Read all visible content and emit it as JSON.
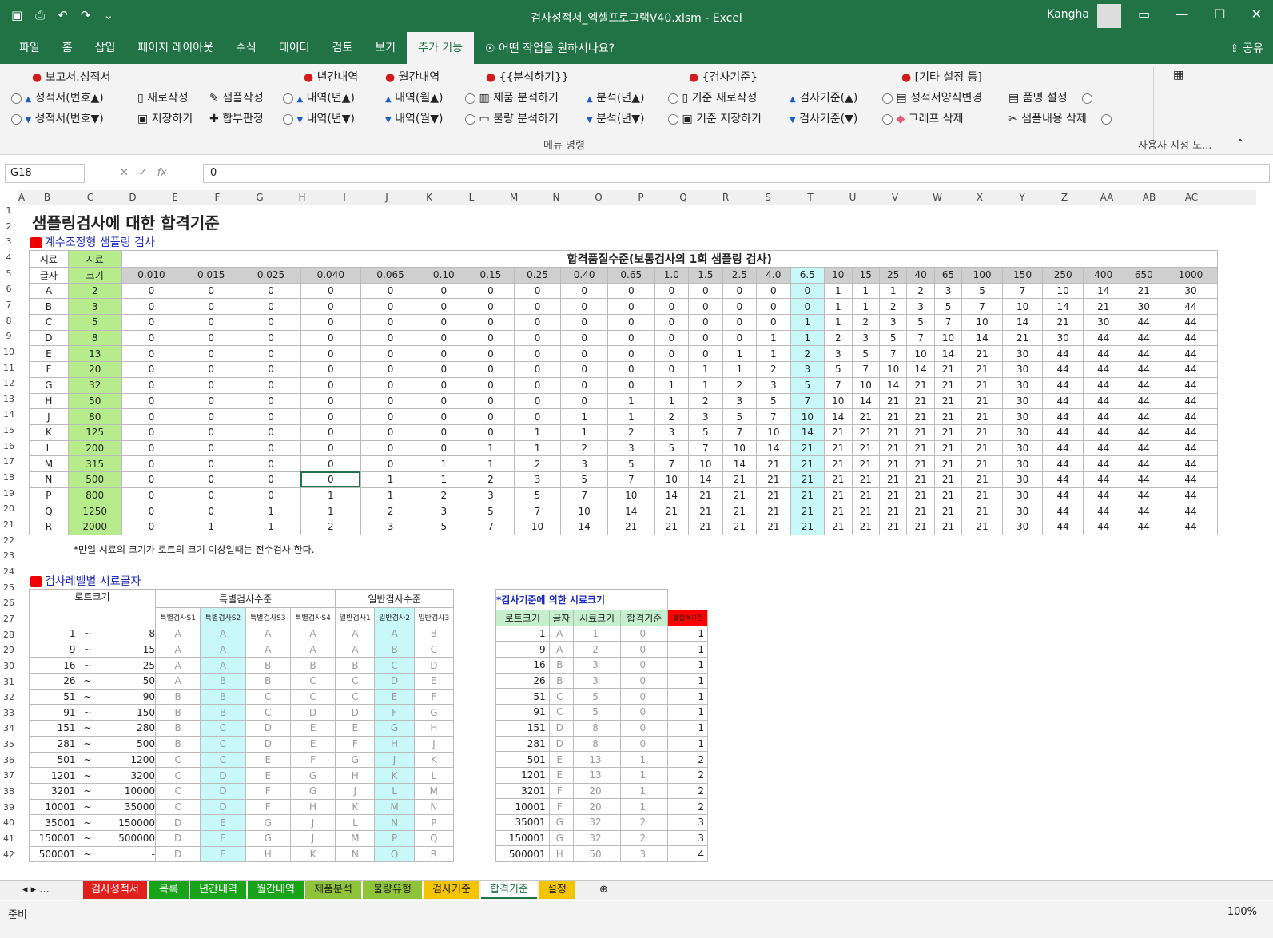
{
  "window": {
    "title": "검사성적서_엑셀프로그램V40.xlsm  -  Excel",
    "user": "Kangha"
  },
  "menu": {
    "tabs": [
      "파일",
      "홈",
      "삽입",
      "페이지 레이아웃",
      "수식",
      "데이터",
      "검토",
      "보기",
      "추가 기능"
    ],
    "active": "추가 기능",
    "tell": "어떤 작업을 원하시나요?",
    "share": "공유"
  },
  "ribbon": {
    "col1": {
      "head": "보고서.성적서",
      "r1": "성적서(번호▲)",
      "r2": "성적서(번호▼)"
    },
    "col2": {
      "r1": "새로작성",
      "r2": "저장하기"
    },
    "col3": {
      "r1": "샘플작성",
      "r2": "합부판정"
    },
    "col4": {
      "head": "년간내역",
      "r1": "내역(년▲)",
      "r2": "내역(년▼)"
    },
    "col5": {
      "head": "월간내역",
      "r1": "내역(월▲)",
      "r2": "내역(월▼)"
    },
    "col6": {
      "head": "{{분석하기}}",
      "r1": "제품 분석하기",
      "r2": "불량 분석하기"
    },
    "col7": {
      "r1": "분석(년▲)",
      "r2": "분석(년▼)"
    },
    "col8": {
      "head": "{검사기준}",
      "r1": "기준 새로작성",
      "r2": "기준 저장하기"
    },
    "col9": {
      "r1": "검사기준(▲)",
      "r2": "검사기준(▼)"
    },
    "col10": {
      "head": "[기타 설정 등]",
      "r1": "성적서양식변경",
      "r2": "그래프 삭제"
    },
    "col11": {
      "r1": "품명 설정",
      "r2": "샘플내용 삭제"
    },
    "group_label": "메뉴 명령",
    "custom_label": "사용자 지정 도..."
  },
  "formula": {
    "cell": "G18",
    "value": "0"
  },
  "columns": [
    "A",
    "B",
    "C",
    "D",
    "E",
    "F",
    "G",
    "H",
    "I",
    "J",
    "K",
    "L",
    "M",
    "N",
    "O",
    "P",
    "Q",
    "R",
    "S",
    "T",
    "U",
    "V",
    "W",
    "X",
    "Y",
    "Z",
    "AA",
    "AB",
    "AC"
  ],
  "rows": [
    "1",
    "2",
    "3",
    "4",
    "5",
    "6",
    "7",
    "8",
    "9",
    "10",
    "11",
    "12",
    "13",
    "14",
    "15",
    "16",
    "17",
    "18",
    "19",
    "20",
    "21",
    "22",
    "23",
    "24",
    "25",
    "26",
    "27",
    "28",
    "29",
    "30",
    "31",
    "32",
    "33",
    "34",
    "35",
    "36",
    "37",
    "38",
    "39",
    "40",
    "41",
    "42"
  ],
  "title": "샘플링검사에 대한 합격기준",
  "section1": "계수조정형 샘플링 검사",
  "section2": "검사레벨별 시료글자",
  "note": "*만일 시료의 크기가 로트의 크기 이상일때는 전수검사 한다.",
  "table1": {
    "h_letter": [
      "시료",
      "글자"
    ],
    "h_size": [
      "시료",
      "크기"
    ],
    "h_aql": "합격품질수준(보통검사의 1회 샘플링 검사)",
    "aql": [
      "0.010",
      "0.015",
      "0.025",
      "0.040",
      "0.065",
      "0.10",
      "0.15",
      "0.25",
      "0.40",
      "0.65",
      "1.0",
      "1.5",
      "2.5",
      "4.0",
      "6.5",
      "10",
      "15",
      "25",
      "40",
      "65",
      "100",
      "150",
      "250",
      "400",
      "650",
      "1000"
    ],
    "rows": [
      [
        "A",
        "2",
        [
          0,
          0,
          0,
          0,
          0,
          0,
          0,
          0,
          0,
          0,
          0,
          0,
          0,
          0,
          0,
          1,
          1,
          1,
          2,
          3,
          5,
          7,
          10,
          14,
          21,
          30
        ]
      ],
      [
        "B",
        "3",
        [
          0,
          0,
          0,
          0,
          0,
          0,
          0,
          0,
          0,
          0,
          0,
          0,
          0,
          0,
          0,
          1,
          1,
          2,
          3,
          5,
          7,
          10,
          14,
          21,
          30,
          44
        ]
      ],
      [
        "C",
        "5",
        [
          0,
          0,
          0,
          0,
          0,
          0,
          0,
          0,
          0,
          0,
          0,
          0,
          0,
          0,
          1,
          1,
          2,
          3,
          5,
          7,
          10,
          14,
          21,
          30,
          44,
          44
        ]
      ],
      [
        "D",
        "8",
        [
          0,
          0,
          0,
          0,
          0,
          0,
          0,
          0,
          0,
          0,
          0,
          0,
          0,
          1,
          1,
          2,
          3,
          5,
          7,
          10,
          14,
          21,
          30,
          44,
          44,
          44
        ]
      ],
      [
        "E",
        "13",
        [
          0,
          0,
          0,
          0,
          0,
          0,
          0,
          0,
          0,
          0,
          0,
          0,
          1,
          1,
          2,
          3,
          5,
          7,
          10,
          14,
          21,
          30,
          44,
          44,
          44,
          44
        ]
      ],
      [
        "F",
        "20",
        [
          0,
          0,
          0,
          0,
          0,
          0,
          0,
          0,
          0,
          0,
          0,
          1,
          1,
          2,
          3,
          5,
          7,
          10,
          14,
          21,
          21,
          30,
          44,
          44,
          44,
          44
        ]
      ],
      [
        "G",
        "32",
        [
          0,
          0,
          0,
          0,
          0,
          0,
          0,
          0,
          0,
          0,
          1,
          1,
          2,
          3,
          5,
          7,
          10,
          14,
          21,
          21,
          21,
          30,
          44,
          44,
          44,
          44
        ]
      ],
      [
        "H",
        "50",
        [
          0,
          0,
          0,
          0,
          0,
          0,
          0,
          0,
          0,
          1,
          1,
          2,
          3,
          5,
          7,
          10,
          14,
          21,
          21,
          21,
          21,
          30,
          44,
          44,
          44,
          44
        ]
      ],
      [
        "J",
        "80",
        [
          0,
          0,
          0,
          0,
          0,
          0,
          0,
          0,
          1,
          1,
          2,
          3,
          5,
          7,
          10,
          14,
          21,
          21,
          21,
          21,
          21,
          30,
          44,
          44,
          44,
          44
        ]
      ],
      [
        "K",
        "125",
        [
          0,
          0,
          0,
          0,
          0,
          0,
          0,
          1,
          1,
          2,
          3,
          5,
          7,
          10,
          14,
          21,
          21,
          21,
          21,
          21,
          21,
          30,
          44,
          44,
          44,
          44
        ]
      ],
      [
        "L",
        "200",
        [
          0,
          0,
          0,
          0,
          0,
          0,
          1,
          1,
          2,
          3,
          5,
          7,
          10,
          14,
          21,
          21,
          21,
          21,
          21,
          21,
          21,
          30,
          44,
          44,
          44,
          44
        ]
      ],
      [
        "M",
        "315",
        [
          0,
          0,
          0,
          0,
          0,
          1,
          1,
          2,
          3,
          5,
          7,
          10,
          14,
          21,
          21,
          21,
          21,
          21,
          21,
          21,
          21,
          30,
          44,
          44,
          44,
          44
        ]
      ],
      [
        "N",
        "500",
        [
          0,
          0,
          0,
          0,
          1,
          1,
          2,
          3,
          5,
          7,
          10,
          14,
          21,
          21,
          21,
          21,
          21,
          21,
          21,
          21,
          21,
          30,
          44,
          44,
          44,
          44
        ]
      ],
      [
        "P",
        "800",
        [
          0,
          0,
          0,
          1,
          1,
          2,
          3,
          5,
          7,
          10,
          14,
          21,
          21,
          21,
          21,
          21,
          21,
          21,
          21,
          21,
          21,
          30,
          44,
          44,
          44,
          44
        ]
      ],
      [
        "Q",
        "1250",
        [
          0,
          0,
          1,
          1,
          2,
          3,
          5,
          7,
          10,
          14,
          21,
          21,
          21,
          21,
          21,
          21,
          21,
          21,
          21,
          21,
          21,
          30,
          44,
          44,
          44,
          44
        ]
      ],
      [
        "R",
        "2000",
        [
          0,
          1,
          1,
          2,
          3,
          5,
          7,
          10,
          14,
          21,
          21,
          21,
          21,
          21,
          21,
          21,
          21,
          21,
          21,
          21,
          21,
          30,
          44,
          44,
          44,
          44
        ]
      ]
    ]
  },
  "table2": {
    "h_lot": "로트크기",
    "h_special": "특별검사수준",
    "h_general": "일반검사수준",
    "tilde": "~",
    "sub": [
      "특별검사S1",
      "특별검사S2",
      "특별검사S3",
      "특별검사S4",
      "일반검사1",
      "일반검사2",
      "일반검사3"
    ],
    "rows": [
      [
        "1",
        "8",
        "A",
        "A",
        "A",
        "A",
        "A",
        "A",
        "B"
      ],
      [
        "9",
        "15",
        "A",
        "A",
        "A",
        "A",
        "A",
        "B",
        "C"
      ],
      [
        "16",
        "25",
        "A",
        "A",
        "B",
        "B",
        "B",
        "C",
        "D"
      ],
      [
        "26",
        "50",
        "A",
        "B",
        "B",
        "C",
        "C",
        "D",
        "E"
      ],
      [
        "51",
        "90",
        "B",
        "B",
        "C",
        "C",
        "C",
        "E",
        "F"
      ],
      [
        "91",
        "150",
        "B",
        "B",
        "C",
        "D",
        "D",
        "F",
        "G"
      ],
      [
        "151",
        "280",
        "B",
        "C",
        "D",
        "E",
        "E",
        "G",
        "H"
      ],
      [
        "281",
        "500",
        "B",
        "C",
        "D",
        "E",
        "F",
        "H",
        "J"
      ],
      [
        "501",
        "1200",
        "C",
        "C",
        "E",
        "F",
        "G",
        "J",
        "K"
      ],
      [
        "1201",
        "3200",
        "C",
        "D",
        "E",
        "G",
        "H",
        "K",
        "L"
      ],
      [
        "3201",
        "10000",
        "C",
        "D",
        "F",
        "G",
        "J",
        "L",
        "M"
      ],
      [
        "10001",
        "35000",
        "C",
        "D",
        "F",
        "H",
        "K",
        "M",
        "N"
      ],
      [
        "35001",
        "150000",
        "D",
        "E",
        "G",
        "J",
        "L",
        "N",
        "P"
      ],
      [
        "150001",
        "500000",
        "D",
        "E",
        "G",
        "J",
        "M",
        "P",
        "Q"
      ],
      [
        "500001",
        "-",
        "D",
        "E",
        "H",
        "K",
        "N",
        "Q",
        "R"
      ]
    ]
  },
  "table3": {
    "title": "*검사기준에 의한 시료크기",
    "heads": [
      "로트크기",
      "글자",
      "시료크기",
      "합격기준",
      "불합격기준"
    ],
    "rows": [
      [
        "1",
        "A",
        "1",
        "0",
        "1"
      ],
      [
        "9",
        "A",
        "2",
        "0",
        "1"
      ],
      [
        "16",
        "B",
        "3",
        "0",
        "1"
      ],
      [
        "26",
        "B",
        "3",
        "0",
        "1"
      ],
      [
        "51",
        "C",
        "5",
        "0",
        "1"
      ],
      [
        "91",
        "C",
        "5",
        "0",
        "1"
      ],
      [
        "151",
        "D",
        "8",
        "0",
        "1"
      ],
      [
        "281",
        "D",
        "8",
        "0",
        "1"
      ],
      [
        "501",
        "E",
        "13",
        "1",
        "2"
      ],
      [
        "1201",
        "E",
        "13",
        "1",
        "2"
      ],
      [
        "3201",
        "F",
        "20",
        "1",
        "2"
      ],
      [
        "10001",
        "F",
        "20",
        "1",
        "2"
      ],
      [
        "35001",
        "G",
        "32",
        "2",
        "3"
      ],
      [
        "150001",
        "G",
        "32",
        "2",
        "3"
      ],
      [
        "500001",
        "H",
        "50",
        "3",
        "4"
      ]
    ]
  },
  "sheets": [
    "검사성적서",
    "목록",
    "년간내역",
    "월간내역",
    "제품분석",
    "불량유형",
    "검사기준",
    "합격기준",
    "설정"
  ],
  "sheet_colors": [
    "#e0201d",
    "#19a319",
    "#19a319",
    "#19a319",
    "#8fc43a",
    "#8fc43a",
    "#f5c400",
    "#ffffff",
    "#f5c400"
  ],
  "active_sheet": "합격기준",
  "status": {
    "ready": "준비",
    "zoom": "100%"
  }
}
